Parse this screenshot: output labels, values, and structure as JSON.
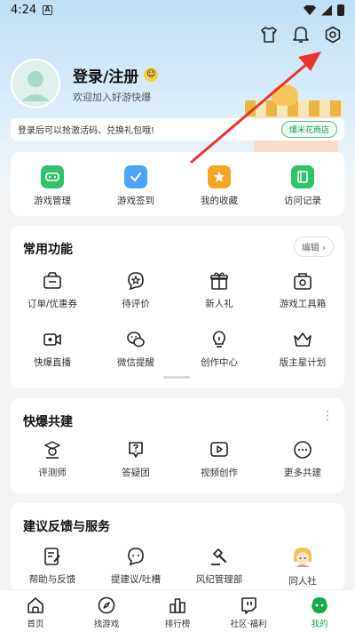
{
  "status_bar": {
    "time": "4:24",
    "notif_letter": "A"
  },
  "profile": {
    "login_label": "登录/注册",
    "welcome": "欢迎加入好游快爆"
  },
  "banner": {
    "text": "登录后可以抢激活码、兑换礼包哦!",
    "shop_button": "爆米花商店"
  },
  "quick": [
    {
      "label": "游戏管理",
      "icon": "gamepad-icon",
      "color": "#2fc36a"
    },
    {
      "label": "游戏签到",
      "icon": "calendar-check-icon",
      "color": "#4da3f7"
    },
    {
      "label": "我的收藏",
      "icon": "star-icon",
      "color": "#f5a623"
    },
    {
      "label": "访问记录",
      "icon": "book-icon",
      "color": "#2fc36a"
    }
  ],
  "common": {
    "title": "常用功能",
    "edit": "编辑 ›",
    "items": [
      {
        "label": "订单/优惠券",
        "icon": "coupon-icon"
      },
      {
        "label": "待评价",
        "icon": "review-star-icon"
      },
      {
        "label": "新人礼",
        "icon": "gift-icon"
      },
      {
        "label": "游戏工具箱",
        "icon": "toolbox-icon"
      },
      {
        "label": "快爆直播",
        "icon": "video-camera-icon"
      },
      {
        "label": "微信提醒",
        "icon": "wechat-icon"
      },
      {
        "label": "创作中心",
        "icon": "bulb-icon"
      },
      {
        "label": "版主星计划",
        "icon": "crown-icon"
      }
    ]
  },
  "cobuild": {
    "title": "快爆共建",
    "items": [
      {
        "label": "评测师",
        "icon": "reviewer-icon"
      },
      {
        "label": "答疑团",
        "icon": "question-icon"
      },
      {
        "label": "视频创作",
        "icon": "play-icon"
      },
      {
        "label": "更多共建",
        "icon": "more-icon"
      }
    ]
  },
  "feedback": {
    "title": "建议反馈与服务",
    "items": [
      {
        "label": "帮助与反馈",
        "icon": "edit-note-icon"
      },
      {
        "label": "提建议/吐槽",
        "icon": "chat-icon"
      },
      {
        "label": "风纪管理部",
        "icon": "gavel-icon"
      },
      {
        "label": "同人社",
        "icon": "anime-avatar-icon"
      }
    ]
  },
  "tabs": [
    {
      "label": "首页",
      "icon": "home-icon",
      "active": false
    },
    {
      "label": "找游戏",
      "icon": "compass-icon",
      "active": false
    },
    {
      "label": "排行榜",
      "icon": "chart-icon",
      "active": false
    },
    {
      "label": "社区·福利",
      "icon": "twitch-icon",
      "active": false
    },
    {
      "label": "我的",
      "icon": "me-icon",
      "active": true
    }
  ],
  "colors": {
    "accent": "#18a94c",
    "arrow": "#e8362a"
  }
}
